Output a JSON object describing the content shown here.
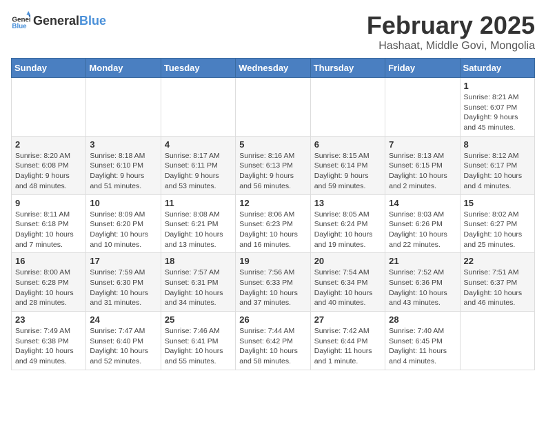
{
  "header": {
    "logo_general": "General",
    "logo_blue": "Blue",
    "month_year": "February 2025",
    "location": "Hashaat, Middle Govi, Mongolia"
  },
  "days_of_week": [
    "Sunday",
    "Monday",
    "Tuesday",
    "Wednesday",
    "Thursday",
    "Friday",
    "Saturday"
  ],
  "weeks": [
    [
      {
        "day": "",
        "info": ""
      },
      {
        "day": "",
        "info": ""
      },
      {
        "day": "",
        "info": ""
      },
      {
        "day": "",
        "info": ""
      },
      {
        "day": "",
        "info": ""
      },
      {
        "day": "",
        "info": ""
      },
      {
        "day": "1",
        "info": "Sunrise: 8:21 AM\nSunset: 6:07 PM\nDaylight: 9 hours and 45 minutes."
      }
    ],
    [
      {
        "day": "2",
        "info": "Sunrise: 8:20 AM\nSunset: 6:08 PM\nDaylight: 9 hours and 48 minutes."
      },
      {
        "day": "3",
        "info": "Sunrise: 8:18 AM\nSunset: 6:10 PM\nDaylight: 9 hours and 51 minutes."
      },
      {
        "day": "4",
        "info": "Sunrise: 8:17 AM\nSunset: 6:11 PM\nDaylight: 9 hours and 53 minutes."
      },
      {
        "day": "5",
        "info": "Sunrise: 8:16 AM\nSunset: 6:13 PM\nDaylight: 9 hours and 56 minutes."
      },
      {
        "day": "6",
        "info": "Sunrise: 8:15 AM\nSunset: 6:14 PM\nDaylight: 9 hours and 59 minutes."
      },
      {
        "day": "7",
        "info": "Sunrise: 8:13 AM\nSunset: 6:15 PM\nDaylight: 10 hours and 2 minutes."
      },
      {
        "day": "8",
        "info": "Sunrise: 8:12 AM\nSunset: 6:17 PM\nDaylight: 10 hours and 4 minutes."
      }
    ],
    [
      {
        "day": "9",
        "info": "Sunrise: 8:11 AM\nSunset: 6:18 PM\nDaylight: 10 hours and 7 minutes."
      },
      {
        "day": "10",
        "info": "Sunrise: 8:09 AM\nSunset: 6:20 PM\nDaylight: 10 hours and 10 minutes."
      },
      {
        "day": "11",
        "info": "Sunrise: 8:08 AM\nSunset: 6:21 PM\nDaylight: 10 hours and 13 minutes."
      },
      {
        "day": "12",
        "info": "Sunrise: 8:06 AM\nSunset: 6:23 PM\nDaylight: 10 hours and 16 minutes."
      },
      {
        "day": "13",
        "info": "Sunrise: 8:05 AM\nSunset: 6:24 PM\nDaylight: 10 hours and 19 minutes."
      },
      {
        "day": "14",
        "info": "Sunrise: 8:03 AM\nSunset: 6:26 PM\nDaylight: 10 hours and 22 minutes."
      },
      {
        "day": "15",
        "info": "Sunrise: 8:02 AM\nSunset: 6:27 PM\nDaylight: 10 hours and 25 minutes."
      }
    ],
    [
      {
        "day": "16",
        "info": "Sunrise: 8:00 AM\nSunset: 6:28 PM\nDaylight: 10 hours and 28 minutes."
      },
      {
        "day": "17",
        "info": "Sunrise: 7:59 AM\nSunset: 6:30 PM\nDaylight: 10 hours and 31 minutes."
      },
      {
        "day": "18",
        "info": "Sunrise: 7:57 AM\nSunset: 6:31 PM\nDaylight: 10 hours and 34 minutes."
      },
      {
        "day": "19",
        "info": "Sunrise: 7:56 AM\nSunset: 6:33 PM\nDaylight: 10 hours and 37 minutes."
      },
      {
        "day": "20",
        "info": "Sunrise: 7:54 AM\nSunset: 6:34 PM\nDaylight: 10 hours and 40 minutes."
      },
      {
        "day": "21",
        "info": "Sunrise: 7:52 AM\nSunset: 6:36 PM\nDaylight: 10 hours and 43 minutes."
      },
      {
        "day": "22",
        "info": "Sunrise: 7:51 AM\nSunset: 6:37 PM\nDaylight: 10 hours and 46 minutes."
      }
    ],
    [
      {
        "day": "23",
        "info": "Sunrise: 7:49 AM\nSunset: 6:38 PM\nDaylight: 10 hours and 49 minutes."
      },
      {
        "day": "24",
        "info": "Sunrise: 7:47 AM\nSunset: 6:40 PM\nDaylight: 10 hours and 52 minutes."
      },
      {
        "day": "25",
        "info": "Sunrise: 7:46 AM\nSunset: 6:41 PM\nDaylight: 10 hours and 55 minutes."
      },
      {
        "day": "26",
        "info": "Sunrise: 7:44 AM\nSunset: 6:42 PM\nDaylight: 10 hours and 58 minutes."
      },
      {
        "day": "27",
        "info": "Sunrise: 7:42 AM\nSunset: 6:44 PM\nDaylight: 11 hours and 1 minute."
      },
      {
        "day": "28",
        "info": "Sunrise: 7:40 AM\nSunset: 6:45 PM\nDaylight: 11 hours and 4 minutes."
      },
      {
        "day": "",
        "info": ""
      }
    ]
  ]
}
